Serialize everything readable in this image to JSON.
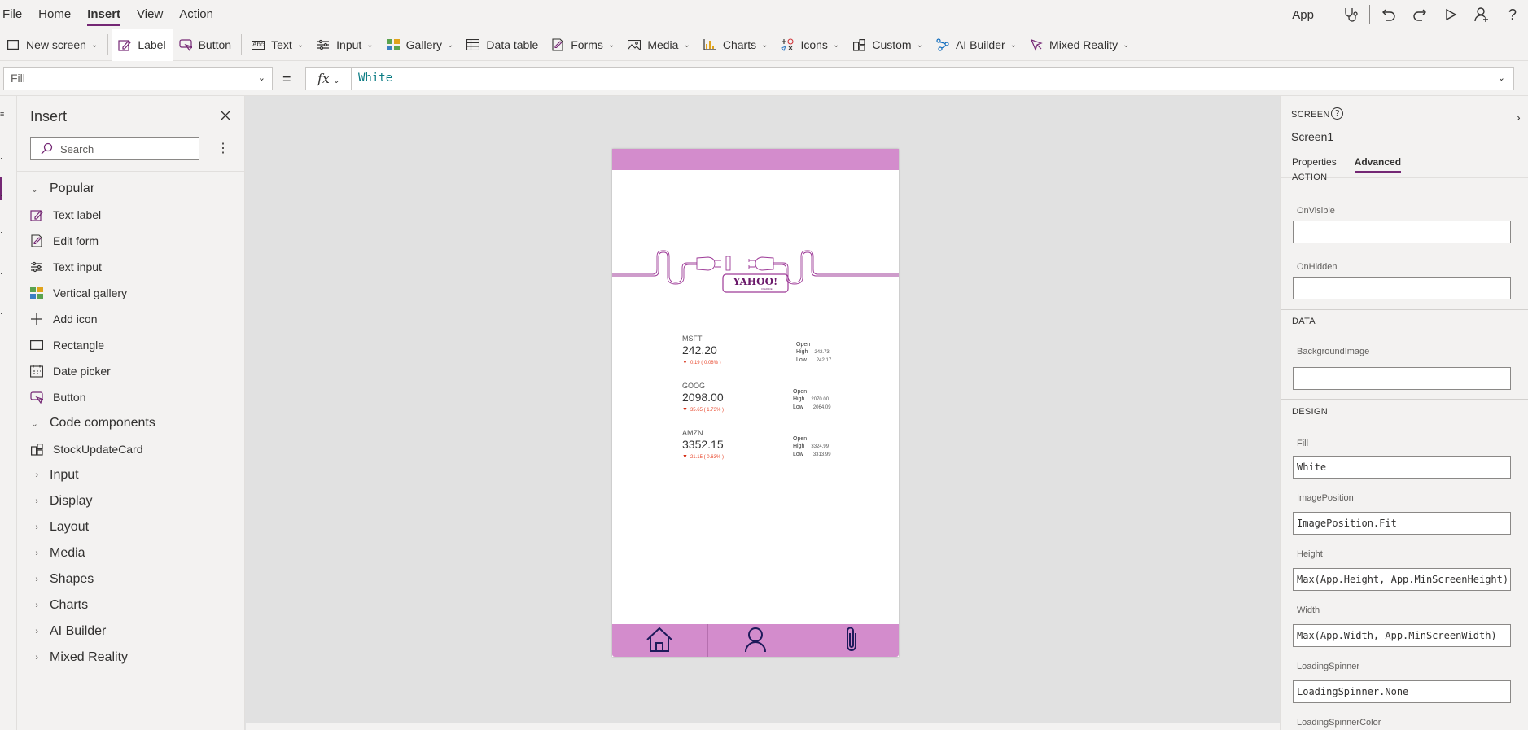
{
  "menu": {
    "items": [
      "File",
      "Home",
      "Insert",
      "View",
      "Action"
    ],
    "active": "Insert",
    "app_label": "App"
  },
  "ribbon": {
    "new_screen": "New screen",
    "label": "Label",
    "button": "Button",
    "text": "Text",
    "input": "Input",
    "gallery": "Gallery",
    "data_table": "Data table",
    "forms": "Forms",
    "media": "Media",
    "charts": "Charts",
    "icons": "Icons",
    "custom": "Custom",
    "ai_builder": "AI Builder",
    "mixed_reality": "Mixed Reality"
  },
  "formula_bar": {
    "property": "Fill",
    "fx": "fx",
    "formula": "White"
  },
  "insert_panel": {
    "title": "Insert",
    "search_placeholder": "Search",
    "groups": [
      {
        "label": "Popular",
        "expanded": true
      },
      {
        "label": "Code components",
        "expanded": true
      },
      {
        "label": "Input"
      },
      {
        "label": "Display"
      },
      {
        "label": "Layout"
      },
      {
        "label": "Media"
      },
      {
        "label": "Shapes"
      },
      {
        "label": "Charts"
      },
      {
        "label": "AI Builder"
      },
      {
        "label": "Mixed Reality"
      }
    ],
    "popular_items": [
      {
        "label": "Text label",
        "icon": "text-label-icon"
      },
      {
        "label": "Edit form",
        "icon": "edit-form-icon"
      },
      {
        "label": "Text input",
        "icon": "text-input-icon"
      },
      {
        "label": "Vertical gallery",
        "icon": "gallery-icon"
      },
      {
        "label": "Add icon",
        "icon": "plus-icon"
      },
      {
        "label": "Rectangle",
        "icon": "rectangle-icon"
      },
      {
        "label": "Date picker",
        "icon": "calendar-icon"
      },
      {
        "label": "Button",
        "icon": "button-icon"
      }
    ],
    "code_items": [
      {
        "label": "StockUpdateCard",
        "icon": "component-icon"
      }
    ]
  },
  "phone": {
    "header_color": "#d38ccc",
    "logo_text": "YAHOO!",
    "logo_sub": "FINANCE",
    "stocks": [
      {
        "ticker": "MSFT",
        "price": "242.20",
        "change": "0.19 ( 0.08% )",
        "open_label": "Open",
        "high_label": "High",
        "high": "242.73",
        "low_label": "Low",
        "low": "242.17"
      },
      {
        "ticker": "GOOG",
        "price": "2098.00",
        "change": "35.65 ( 1.73% )",
        "open_label": "Open",
        "high_label": "High",
        "high": "2070.00",
        "low_label": "Low",
        "low": "2064.09"
      },
      {
        "ticker": "AMZN",
        "price": "3352.15",
        "change": "21.15 ( 0.63% )",
        "open_label": "Open",
        "high_label": "High",
        "high": "3324.99",
        "low_label": "Low",
        "low": "3313.99"
      }
    ],
    "nav": [
      "home-icon",
      "person-icon",
      "paperclip-icon"
    ]
  },
  "right_panel": {
    "section_label": "SCREEN",
    "screen_name": "Screen1",
    "tabs": [
      "Properties",
      "Advanced"
    ],
    "active_tab": "Advanced",
    "cut_section": "ACTION",
    "action": {
      "on_visible_label": "OnVisible",
      "on_visible_value": "",
      "on_hidden_label": "OnHidden",
      "on_hidden_value": ""
    },
    "data_section": "DATA",
    "data": {
      "bg_image_label": "BackgroundImage",
      "bg_image_value": ""
    },
    "design_section": "DESIGN",
    "design": {
      "fill_label": "Fill",
      "fill_value": "White",
      "image_position_label": "ImagePosition",
      "image_position_value": "ImagePosition.Fit",
      "height_label": "Height",
      "height_value": "Max(App.Height, App.MinScreenHeight)",
      "width_label": "Width",
      "width_value": "Max(App.Width, App.MinScreenWidth)",
      "loading_spinner_label": "LoadingSpinner",
      "loading_spinner_value": "LoadingSpinner.None",
      "loading_spinner_color_label": "LoadingSpinnerColor"
    }
  },
  "colors": {
    "accent": "#742774",
    "phone_pink": "#d38ccc",
    "formula_teal": "#0a7b83",
    "down_red": "#e8462b"
  }
}
